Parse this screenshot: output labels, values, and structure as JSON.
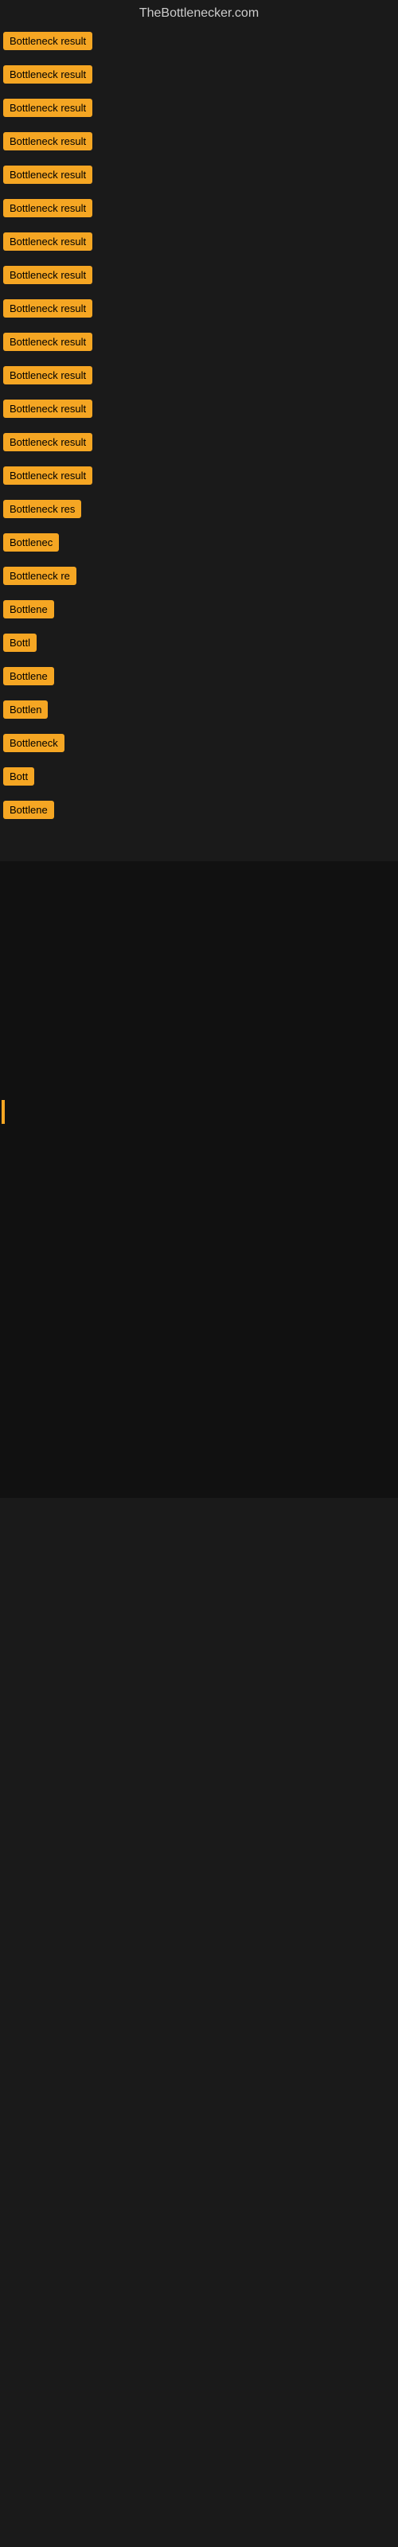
{
  "site": {
    "title": "TheBottlenecker.com"
  },
  "items": [
    {
      "label": "Bottleneck result",
      "width": 140
    },
    {
      "label": "Bottleneck result",
      "width": 140
    },
    {
      "label": "Bottleneck result",
      "width": 140
    },
    {
      "label": "Bottleneck result",
      "width": 140
    },
    {
      "label": "Bottleneck result",
      "width": 140
    },
    {
      "label": "Bottleneck result",
      "width": 140
    },
    {
      "label": "Bottleneck result",
      "width": 140
    },
    {
      "label": "Bottleneck result",
      "width": 140
    },
    {
      "label": "Bottleneck result",
      "width": 140
    },
    {
      "label": "Bottleneck result",
      "width": 140
    },
    {
      "label": "Bottleneck result",
      "width": 140
    },
    {
      "label": "Bottleneck result",
      "width": 140
    },
    {
      "label": "Bottleneck result",
      "width": 140
    },
    {
      "label": "Bottleneck result",
      "width": 140
    },
    {
      "label": "Bottleneck res",
      "width": 120
    },
    {
      "label": "Bottlenec",
      "width": 85
    },
    {
      "label": "Bottleneck re",
      "width": 105
    },
    {
      "label": "Bottlene",
      "width": 78
    },
    {
      "label": "Bottl",
      "width": 55
    },
    {
      "label": "Bottlene",
      "width": 78
    },
    {
      "label": "Bottlen",
      "width": 68
    },
    {
      "label": "Bottleneck",
      "width": 90
    },
    {
      "label": "Bott",
      "width": 48
    },
    {
      "label": "Bottlene",
      "width": 78
    }
  ]
}
